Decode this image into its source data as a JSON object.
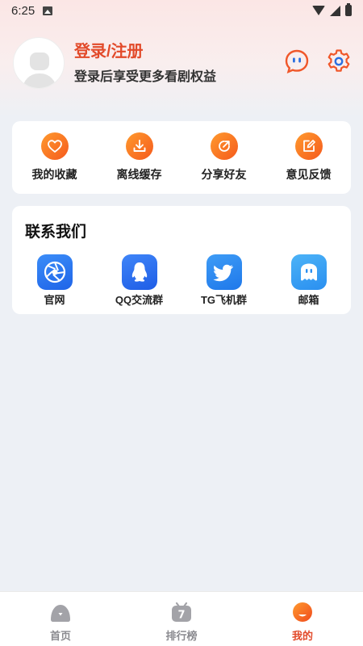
{
  "status_bar": {
    "time": "6:25"
  },
  "profile": {
    "title": "登录/注册",
    "subtitle": "登录后享受更多看剧权益"
  },
  "top_icons": [
    "message-icon",
    "gear-icon"
  ],
  "actions": [
    {
      "label": "我的收藏",
      "icon": "heart-icon"
    },
    {
      "label": "离线缓存",
      "icon": "download-icon"
    },
    {
      "label": "分享好友",
      "icon": "share-icon"
    },
    {
      "label": "意见反馈",
      "icon": "feedback-icon"
    }
  ],
  "contact": {
    "title": "联系我们",
    "items": [
      {
        "label": "官网",
        "icon": "aperture-icon",
        "color": "#2f7ef6"
      },
      {
        "label": "QQ交流群",
        "icon": "qq-icon",
        "color": "#2e74f2"
      },
      {
        "label": "TG飞机群",
        "icon": "twitter-bird-icon",
        "color": "#2d8bf0"
      },
      {
        "label": "邮箱",
        "icon": "chat-bubble-icon",
        "color": "#3aa2f2"
      }
    ]
  },
  "tabs": [
    {
      "label": "首页",
      "icon": "home-icon",
      "active": false
    },
    {
      "label": "排行榜",
      "icon": "ranking-icon",
      "active": false,
      "badge": "7"
    },
    {
      "label": "我的",
      "icon": "profile-icon",
      "active": true
    }
  ],
  "colors": {
    "accent": "#e24a2a",
    "accent_gradient_start": "#ff9a2e",
    "accent_gradient_end": "#f55a1d",
    "inactive": "#888888",
    "background": "#edf0f5"
  }
}
